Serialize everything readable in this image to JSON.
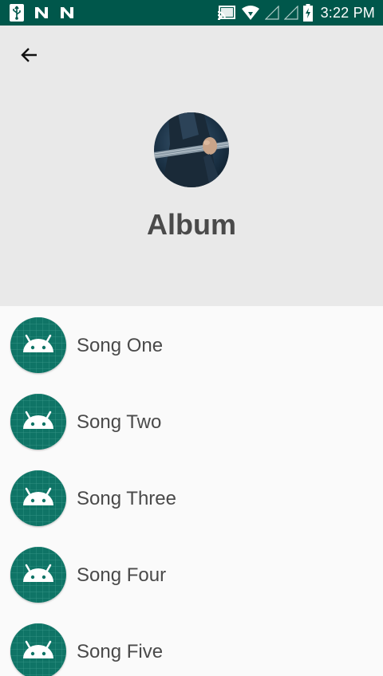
{
  "status_bar": {
    "time": "3:22 PM",
    "left_icons": [
      "usb-icon",
      "n-notification-icon",
      "n-notification-icon"
    ],
    "right_icons": [
      "cast-icon",
      "wifi-icon",
      "signal-icon",
      "signal-icon",
      "battery-charging-icon"
    ]
  },
  "header": {
    "back_icon": "arrow-back-icon",
    "album_art": "guitar-player-photo",
    "title": "Album"
  },
  "songs": [
    {
      "label": "Song One",
      "icon": "android-icon"
    },
    {
      "label": "Song Two",
      "icon": "android-icon"
    },
    {
      "label": "Song Three",
      "icon": "android-icon"
    },
    {
      "label": "Song Four",
      "icon": "android-icon"
    },
    {
      "label": "Song Five",
      "icon": "android-icon"
    }
  ],
  "colors": {
    "status_bar": "#00574b",
    "header_bg": "#e9e9e9",
    "list_bg": "#fafafa",
    "icon_teal": "#0f7466",
    "text": "#4a4a4a"
  }
}
